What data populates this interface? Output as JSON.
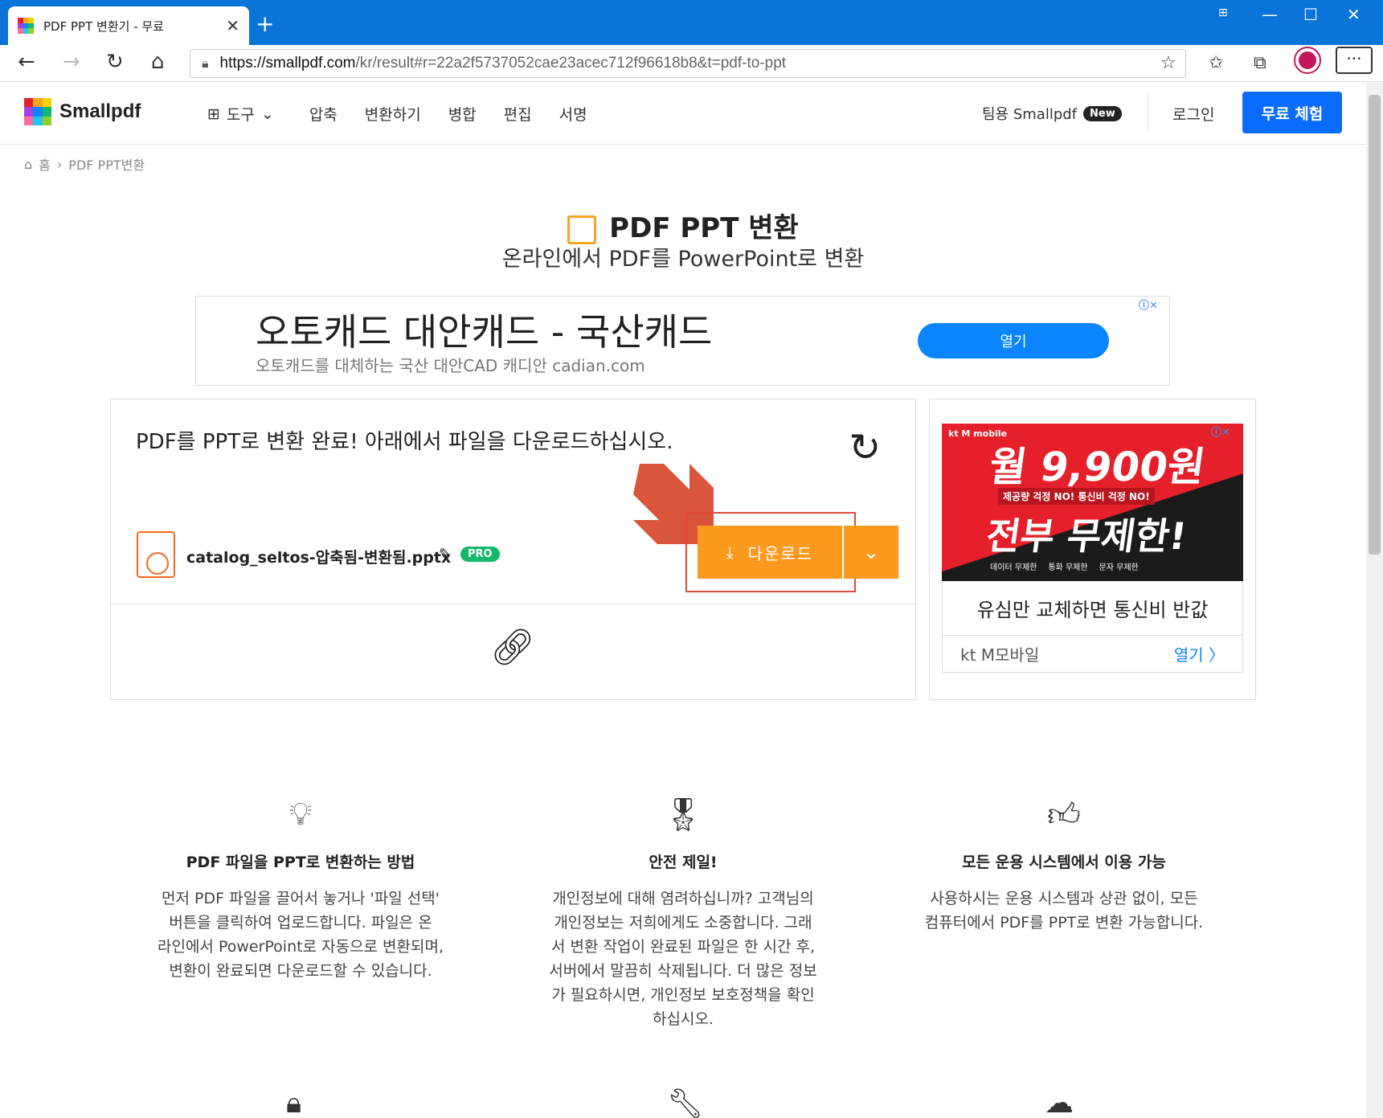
{
  "browser": {
    "tab_title": "PDF PPT 변환기 - 무료",
    "url_host": "https://smallpdf.com",
    "url_path": "/kr/result#r=22a2f5737052cae23acec712f96618b8&t=pdf-to-ppt"
  },
  "header": {
    "logo": "Smallpdf",
    "nav": [
      "도구",
      "압축",
      "변환하기",
      "병합",
      "편집",
      "서명"
    ],
    "team": "팀용 Smallpdf",
    "new_badge": "New",
    "login": "로그인",
    "trial": "무료 체험"
  },
  "breadcrumb": {
    "home": "홈",
    "current": "PDF PPT변환"
  },
  "hero": {
    "title": "PDF PPT 변환",
    "subtitle": "온라인에서 PDF를 PowerPoint로 변환"
  },
  "ad_top": {
    "headline": "오토캐드 대안캐드 - 국산캐드",
    "desc": "오토캐드를 대체하는 국산 대안CAD 캐디안 cadian.com",
    "button": "열기"
  },
  "result": {
    "message": "PDF를 PPT로 변환 완료! 아래에서 파일을 다운로드하십시오.",
    "file_name": "catalog_seltos-압축됨-변환됨.pptx",
    "pro_badge": "PRO",
    "download": "다운로드"
  },
  "side_ad": {
    "brand": "kt M mobile",
    "price": "월 9,900원",
    "small": "제공량 걱정 NO! 통신비 걱정 NO!",
    "headline": "전부 무제한!",
    "tags": [
      "데이터 무제한",
      "통화 무제한",
      "문자 무제한"
    ],
    "tagline": "유심만 교체하면 통신비 반값",
    "advertiser": "kt M모바일",
    "open": "열기 〉"
  },
  "features": [
    {
      "title": "PDF 파일을 PPT로 변환하는 방법",
      "lines": [
        "먼저 PDF 파일을 끌어서 놓거나 '파일 선택'",
        "버튼을 클릭하여 업로드합니다. 파일은 온",
        "라인에서 PowerPoint로 자동으로 변환되며,",
        "변환이 완료되면 다운로드할 수 있습니다."
      ]
    },
    {
      "title": "안전 제일!",
      "lines": [
        "개인정보에 대해 염려하십니까? 고객님의",
        "개인정보는 저희에게도 소중합니다. 그래",
        "서 변환 작업이 완료된 파일은 한 시간 후,",
        "서버에서 말끔히 삭제됩니다. 더 많은 정보",
        "가 필요하시면, 개인정보 보호정책을 확인",
        "하십시오."
      ]
    },
    {
      "title": "모든 운용 시스템에서 이용 가능",
      "lines": [
        "사용하시는 운용 시스템과 상관 없이, 모든",
        "컴퓨터에서 PDF를 PPT로 변환 가능합니다."
      ]
    }
  ],
  "colors": {
    "accent": "#0a6cff",
    "download": "#fb9a1f",
    "highlight": "#e04b3a",
    "pro": "#14b86a"
  }
}
